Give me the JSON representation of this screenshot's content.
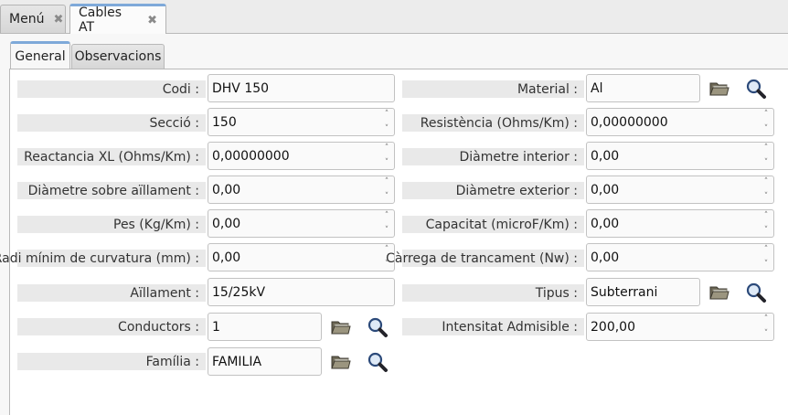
{
  "top_tabs": [
    {
      "label": "Menú",
      "close": "✖"
    },
    {
      "label": "Cables AT",
      "close": "✖"
    }
  ],
  "inner_tabs": [
    {
      "label": "General"
    },
    {
      "label": "Observacions"
    }
  ],
  "left": {
    "codi": {
      "label": "Codi :",
      "value": "DHV 150"
    },
    "seccio": {
      "label": "Secció :",
      "value": "150"
    },
    "reactancia": {
      "label": "Reactancia XL (Ohms/Km) :",
      "value": "0,00000000"
    },
    "diametre_sobre": {
      "label": "Diàmetre sobre aïllament :",
      "value": "0,00"
    },
    "pes": {
      "label": "Pes (Kg/Km) :",
      "value": "0,00"
    },
    "radi": {
      "label": "Radi mínim de curvatura (mm) :",
      "value": "0,00"
    },
    "aillament": {
      "label": "Aïllament :",
      "value": "15/25kV"
    },
    "conductors": {
      "label": "Conductors :",
      "value": "1"
    },
    "familia": {
      "label": "Família :",
      "value": "FAMILIA"
    }
  },
  "right": {
    "material": {
      "label": "Material :",
      "value": "Al"
    },
    "resistencia": {
      "label": "Resistència (Ohms/Km) :",
      "value": "0,00000000"
    },
    "diametre_interior": {
      "label": "Diàmetre interior :",
      "value": "0,00"
    },
    "diametre_exterior": {
      "label": "Diàmetre exterior :",
      "value": "0,00"
    },
    "capacitat": {
      "label": "Capacitat (microF/Km) :",
      "value": "0,00"
    },
    "carrega": {
      "label": "Càrrega de trancament (Nw) :",
      "value": "0,00"
    },
    "tipus": {
      "label": "Tipus :",
      "value": "Subterrani"
    },
    "intensitat": {
      "label": "Intensitat Admisible :",
      "value": "200,00"
    }
  },
  "spin": {
    "up": "˄",
    "down": "˅"
  },
  "icons": {
    "browse": "folder-icon",
    "search": "search-icon"
  },
  "colors": {
    "active_tab_accent": "#7ea9d9",
    "label_bar": "#e9e9e9"
  }
}
